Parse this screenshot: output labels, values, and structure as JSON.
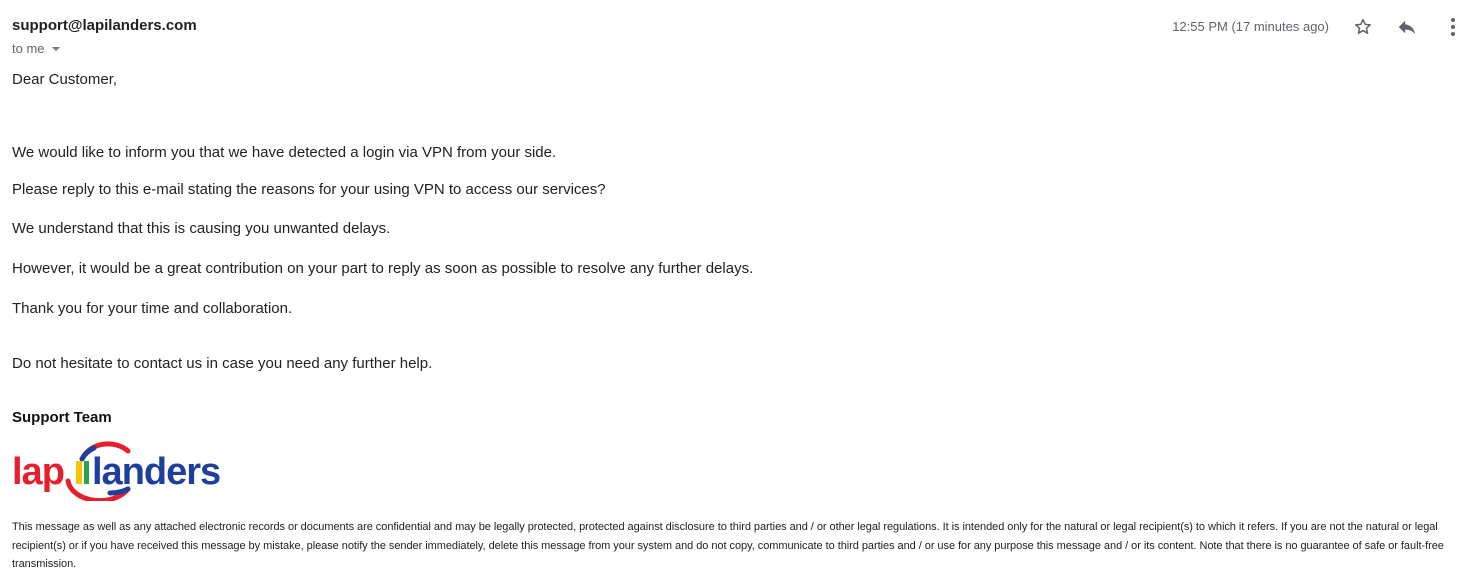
{
  "email": {
    "sender": "support@lapilanders.com",
    "recipient_label": "to me",
    "timestamp": "12:55 PM (17 minutes ago)",
    "greeting": "Dear Customer,",
    "paragraphs": [
      "We would like to inform you that we have detected a login via VPN from your side.",
      "Please reply to this e-mail stating the reasons for your using VPN to access our services?",
      "We understand that this is causing you unwanted delays.",
      "However, it would be a great contribution on your part to reply as soon as possible to resolve any further delays.",
      "Thank you for your time and collaboration.",
      "Do not hesitate to contact us in case you need any further help."
    ],
    "signature": "Support Team",
    "logo_text": "lapilanders",
    "disclaimer": "This message as well as any attached electronic records or documents are confidential and may be legally protected, protected against disclosure to third parties and / or other legal regulations. It is intended only for the natural or legal recipient(s) to which it refers. If you are not the natural or legal recipient(s) or if you have received this message by mistake, please notify the sender immediately, delete this message from your system and do not copy, communicate to third parties and / or use for any purpose this message and / or its content. Note that there is no guarantee of safe or fault-free transmission."
  },
  "toolbar": {
    "icons": [
      "star-icon",
      "reply-icon",
      "more-vert-icon"
    ]
  },
  "colors": {
    "logo_red": "#e4202e",
    "logo_blue": "#1d3f9e",
    "logo_yellow": "#f5c400",
    "logo_green": "#2aa34a"
  }
}
